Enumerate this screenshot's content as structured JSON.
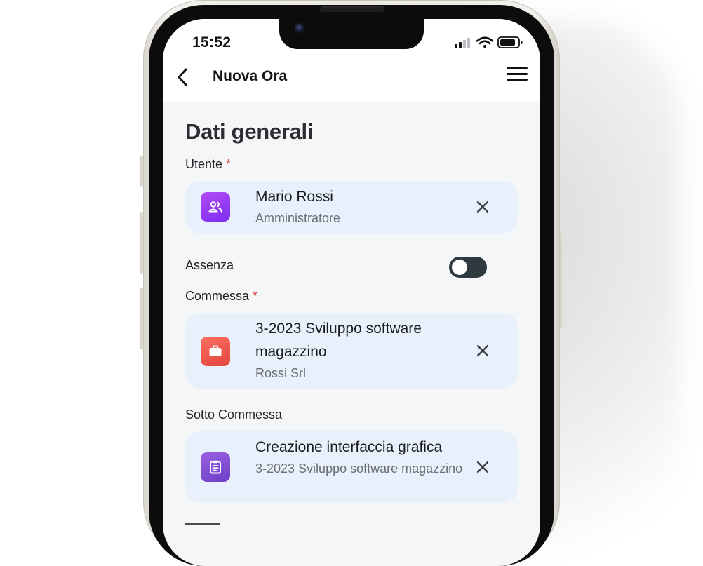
{
  "status_bar": {
    "time": "15:52"
  },
  "app_bar": {
    "title": "Nuova Ora",
    "back_icon": "chevron-left-icon",
    "menu_icon": "hamburger-menu-icon"
  },
  "section": {
    "title": "Dati generali"
  },
  "fields": {
    "utente": {
      "label": "Utente",
      "required": "*",
      "primary": "Mario Rossi",
      "secondary": "Amministratore",
      "icon": "users-icon",
      "icon_color": "#8c3ff3"
    },
    "assenza": {
      "label": "Assenza",
      "toggle_on": false
    },
    "commessa": {
      "label": "Commessa",
      "required": "*",
      "primary": "3-2023 Sviluppo software magazzino",
      "secondary": "Rossi Srl",
      "icon": "briefcase-icon",
      "icon_color": "#f0524a"
    },
    "sotto_commessa": {
      "label": "Sotto Commessa",
      "primary": "Creazione interfaccia grafica",
      "secondary": "3-2023 Sviluppo software magazzino",
      "icon": "clipboard-icon",
      "icon_color": "#7a48d3"
    }
  },
  "colors": {
    "card_background": "#e8f0fb",
    "required_marker": "#d32f2f",
    "toggle_off": "#2f3a40"
  }
}
